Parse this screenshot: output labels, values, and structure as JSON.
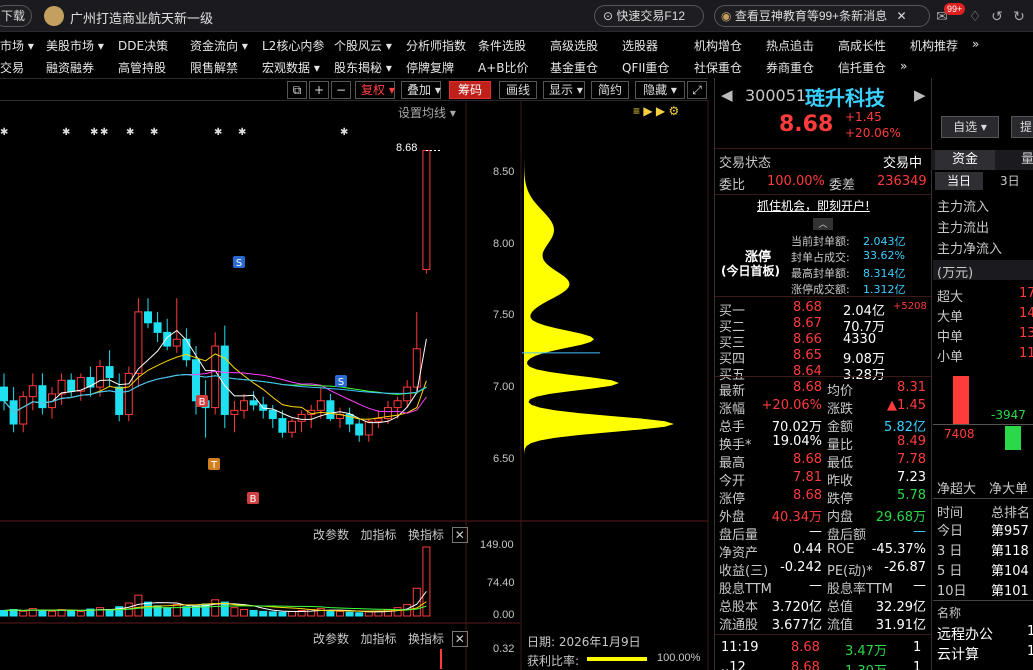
{
  "topbar": {
    "download": "下载",
    "ad_text": "广州打造商业航天新一级",
    "quick_trade": "快速交易F12",
    "news_text": "查看豆神教育等99+条新消息",
    "badge": "99+"
  },
  "menu1": [
    "市场 ▾",
    "美股市场 ▾",
    "DDE决策",
    "资金流向 ▾",
    "L2核心内参",
    "个股风云 ▾",
    "分析师指数",
    "条件选股",
    "高级选股",
    "选股器",
    "机构增仓",
    "热点追击",
    "高成长性",
    "机构推荐",
    "»"
  ],
  "menu2": [
    "交易",
    "融资融券",
    "高管持股",
    "限售解禁",
    "宏观数据 ▾",
    "股东揭秘 ▾",
    "停牌复牌",
    "A+B比价",
    "基金重仓",
    "QFII重仓",
    "社保重仓",
    "券商重仓",
    "信托重仓",
    "»"
  ],
  "toolbar": {
    "fq": "复权 ▾",
    "overlay": "叠加 ▾",
    "chips": "筹码",
    "draw": "画线",
    "display": "显示 ▾",
    "simple": "简约",
    "hide": "隐藏 ▾",
    "setting_ma": "设置均线 ▾"
  },
  "chart": {
    "price_labels": [
      "8.50",
      "8.00",
      "7.50",
      "7.00",
      "6.50"
    ],
    "last_price_tag": "8.68",
    "vol_labels": [
      "149.00",
      "74.40",
      "0.00"
    ],
    "ind_top_label": "0.32",
    "indicator_btns": [
      "改参数",
      "加指标",
      "换指标"
    ],
    "date_label": "日期: 2026年1月9日",
    "profit_label": "获利比率:",
    "profit_value": "100.00%"
  },
  "stock": {
    "code": "300051",
    "name": "琏升科技",
    "price": "8.68",
    "change": "+1.45",
    "change_pct": "+20.06%",
    "watch_btn": "自选 ▾",
    "extra_btn": "提"
  },
  "status": {
    "label": "交易状态",
    "value": "交易中",
    "wb_label": "委比",
    "wb_value": "100.00%",
    "wc_label": "委差",
    "wc_value": "236349",
    "promo": "抓住机会，即刻开户!"
  },
  "limit": {
    "title1": "涨停",
    "title2": "(今日首板)",
    "rows": [
      {
        "label": "当前封单额:",
        "value": "2.043亿"
      },
      {
        "label": "封单占成交:",
        "value": "33.62%"
      },
      {
        "label": "最高封单额:",
        "value": "8.314亿"
      },
      {
        "label": "涨停成交额:",
        "value": "1.312亿"
      }
    ]
  },
  "book": [
    {
      "label": "买一",
      "price": "8.68",
      "vol": "2.04亿",
      "extra": "+5208"
    },
    {
      "label": "买二",
      "price": "8.67",
      "vol": "70.7万",
      "extra": ""
    },
    {
      "label": "买三",
      "price": "8.66",
      "vol": "4330",
      "extra": ""
    },
    {
      "label": "买四",
      "price": "8.65",
      "vol": "9.08万",
      "extra": ""
    },
    {
      "label": "买五",
      "price": "8.64",
      "vol": "3.28万",
      "extra": ""
    }
  ],
  "stats": [
    {
      "l1": "最新",
      "v1": "8.68",
      "c1": "red",
      "l2": "均价",
      "v2": "8.31",
      "c2": "red"
    },
    {
      "l1": "涨幅",
      "v1": "+20.06%",
      "c1": "red",
      "l2": "涨跌",
      "v2": "▲1.45",
      "c2": "red"
    },
    {
      "l1": "总手",
      "v1": "70.02万",
      "c1": "white",
      "l2": "金额",
      "v2": "5.82亿",
      "c2": "cyan"
    },
    {
      "l1": "换手*",
      "v1": "19.04%",
      "c1": "white",
      "l2": "量比",
      "v2": "8.49",
      "c2": "red"
    },
    {
      "l1": "最高",
      "v1": "8.68",
      "c1": "red",
      "l2": "最低",
      "v2": "7.78",
      "c2": "red"
    },
    {
      "l1": "今开",
      "v1": "7.81",
      "c1": "red",
      "l2": "昨收",
      "v2": "7.23",
      "c2": "white"
    },
    {
      "l1": "涨停",
      "v1": "8.68",
      "c1": "red",
      "l2": "跌停",
      "v2": "5.78",
      "c2": "green"
    },
    {
      "l1": "外盘",
      "v1": "40.34万",
      "c1": "red",
      "l2": "内盘",
      "v2": "29.68万",
      "c2": "green"
    },
    {
      "l1": "盘后量",
      "v1": "—",
      "c1": "white",
      "l2": "盘后额",
      "v2": "—",
      "c2": "cyan"
    },
    {
      "l1": "净资产",
      "v1": "0.44",
      "c1": "white",
      "l2": "ROE",
      "v2": "-45.37%",
      "c2": "white"
    },
    {
      "l1": "收益(三)",
      "v1": "-0.242",
      "c1": "white",
      "l2": "PE(动)*",
      "v2": "-26.87",
      "c2": "white"
    },
    {
      "l1": "股息TTM",
      "v1": "—",
      "c1": "white",
      "l2": "股息率TTM",
      "v2": "—",
      "c2": "white"
    },
    {
      "l1": "总股本",
      "v1": "3.720亿",
      "c1": "white",
      "l2": "总值",
      "v2": "32.29亿",
      "c2": "white"
    },
    {
      "l1": "流通股",
      "v1": "3.677亿",
      "c1": "white",
      "l2": "流值",
      "v2": "31.91亿",
      "c2": "white"
    }
  ],
  "ticks": [
    {
      "time": "11:19",
      "price": "8.68",
      "vol": "3.47万",
      "n": "1"
    },
    {
      "time": "..12",
      "price": "8.68",
      "vol": "1.30万",
      "n": "1"
    }
  ],
  "fund": {
    "tabs": [
      "资金",
      "量"
    ],
    "subtabs": [
      "当日",
      "3日"
    ],
    "rows1": [
      "主力流入",
      "主力流出",
      "主力净流入"
    ],
    "unit": "(万元)",
    "rows2": [
      {
        "label": "超大",
        "value": "17"
      },
      {
        "label": "大单",
        "value": "14"
      },
      {
        "label": "中单",
        "value": "13"
      },
      {
        "label": "小单",
        "value": "11"
      }
    ],
    "bar_pos": "7408",
    "bar_neg": "-3947",
    "net_labels": [
      "净超大",
      "净大单"
    ],
    "rank_title": [
      "时间",
      "总排名"
    ],
    "ranks": [
      {
        "label": "今日",
        "value": "第957"
      },
      {
        "label": "3 日",
        "value": "第118"
      },
      {
        "label": "5 日",
        "value": "第104"
      },
      {
        "label": "10日",
        "value": "第101"
      }
    ],
    "concept_title": "名称",
    "concepts": [
      {
        "label": "远程办公",
        "value": "1"
      },
      {
        "label": "云计算",
        "value": "1"
      }
    ]
  },
  "colors": {
    "up": "#ff3b3b",
    "down": "#1ee0f0",
    "chip": "#ffff00"
  },
  "chart_data": {
    "type": "candlestick",
    "ylim": [
      6.3,
      8.72
    ],
    "candles": [
      {
        "o": 6.95,
        "h": 7.05,
        "l": 6.78,
        "c": 6.85
      },
      {
        "o": 6.85,
        "h": 6.95,
        "l": 6.62,
        "c": 6.68
      },
      {
        "o": 6.68,
        "h": 6.92,
        "l": 6.62,
        "c": 6.88
      },
      {
        "o": 6.88,
        "h": 7.05,
        "l": 6.78,
        "c": 6.96
      },
      {
        "o": 6.96,
        "h": 7.05,
        "l": 6.75,
        "c": 6.8
      },
      {
        "o": 6.8,
        "h": 6.95,
        "l": 6.72,
        "c": 6.9
      },
      {
        "o": 6.9,
        "h": 7.05,
        "l": 6.82,
        "c": 7.0
      },
      {
        "o": 7.0,
        "h": 7.05,
        "l": 6.88,
        "c": 6.92
      },
      {
        "o": 6.92,
        "h": 7.05,
        "l": 6.85,
        "c": 7.02
      },
      {
        "o": 7.02,
        "h": 7.1,
        "l": 6.88,
        "c": 6.95
      },
      {
        "o": 6.95,
        "h": 7.15,
        "l": 6.88,
        "c": 7.1
      },
      {
        "o": 7.1,
        "h": 7.22,
        "l": 6.95,
        "c": 7.02
      },
      {
        "o": 6.95,
        "h": 7.05,
        "l": 6.7,
        "c": 6.75
      },
      {
        "o": 6.75,
        "h": 7.1,
        "l": 6.7,
        "c": 7.05
      },
      {
        "o": 7.05,
        "h": 7.6,
        "l": 6.95,
        "c": 7.5
      },
      {
        "o": 7.5,
        "h": 7.6,
        "l": 7.38,
        "c": 7.42
      },
      {
        "o": 7.42,
        "h": 7.5,
        "l": 7.28,
        "c": 7.35
      },
      {
        "o": 7.35,
        "h": 7.45,
        "l": 7.22,
        "c": 7.25
      },
      {
        "o": 7.25,
        "h": 7.6,
        "l": 7.2,
        "c": 7.3
      },
      {
        "o": 7.3,
        "h": 7.38,
        "l": 7.1,
        "c": 7.15
      },
      {
        "o": 7.15,
        "h": 7.25,
        "l": 6.75,
        "c": 6.85
      },
      {
        "o": 6.85,
        "h": 7.0,
        "l": 6.58,
        "c": 6.8
      },
      {
        "o": 6.8,
        "h": 7.35,
        "l": 6.75,
        "c": 7.25
      },
      {
        "o": 7.25,
        "h": 7.4,
        "l": 6.65,
        "c": 6.75
      },
      {
        "o": 6.75,
        "h": 6.85,
        "l": 6.62,
        "c": 6.78
      },
      {
        "o": 6.78,
        "h": 6.9,
        "l": 6.72,
        "c": 6.85
      },
      {
        "o": 6.85,
        "h": 6.92,
        "l": 6.78,
        "c": 6.82
      },
      {
        "o": 6.82,
        "h": 6.88,
        "l": 6.72,
        "c": 6.78
      },
      {
        "o": 6.78,
        "h": 6.82,
        "l": 6.65,
        "c": 6.72
      },
      {
        "o": 6.72,
        "h": 6.78,
        "l": 6.58,
        "c": 6.62
      },
      {
        "o": 6.62,
        "h": 6.72,
        "l": 6.58,
        "c": 6.7
      },
      {
        "o": 6.7,
        "h": 6.78,
        "l": 6.62,
        "c": 6.75
      },
      {
        "o": 6.75,
        "h": 6.82,
        "l": 6.65,
        "c": 6.78
      },
      {
        "o": 6.78,
        "h": 6.95,
        "l": 6.72,
        "c": 6.85
      },
      {
        "o": 6.85,
        "h": 6.9,
        "l": 6.7,
        "c": 6.72
      },
      {
        "o": 6.72,
        "h": 6.8,
        "l": 6.65,
        "c": 6.75
      },
      {
        "o": 6.75,
        "h": 6.8,
        "l": 6.62,
        "c": 6.68
      },
      {
        "o": 6.68,
        "h": 6.72,
        "l": 6.55,
        "c": 6.6
      },
      {
        "o": 6.6,
        "h": 6.72,
        "l": 6.55,
        "c": 6.7
      },
      {
        "o": 6.7,
        "h": 6.78,
        "l": 6.65,
        "c": 6.72
      },
      {
        "o": 6.72,
        "h": 6.85,
        "l": 6.68,
        "c": 6.8
      },
      {
        "o": 6.8,
        "h": 6.88,
        "l": 6.72,
        "c": 6.85
      },
      {
        "o": 6.85,
        "h": 7.0,
        "l": 6.8,
        "c": 6.95
      },
      {
        "o": 6.95,
        "h": 7.5,
        "l": 6.9,
        "c": 7.23
      },
      {
        "o": 7.81,
        "h": 8.68,
        "l": 7.78,
        "c": 8.68
      }
    ],
    "volumes": [
      12,
      14,
      10,
      16,
      12,
      10,
      14,
      12,
      10,
      15,
      18,
      14,
      20,
      28,
      45,
      30,
      22,
      18,
      25,
      20,
      22,
      26,
      35,
      30,
      18,
      14,
      12,
      10,
      9,
      8,
      10,
      12,
      14,
      16,
      12,
      10,
      8,
      7,
      9,
      10,
      14,
      18,
      25,
      60,
      149
    ]
  }
}
